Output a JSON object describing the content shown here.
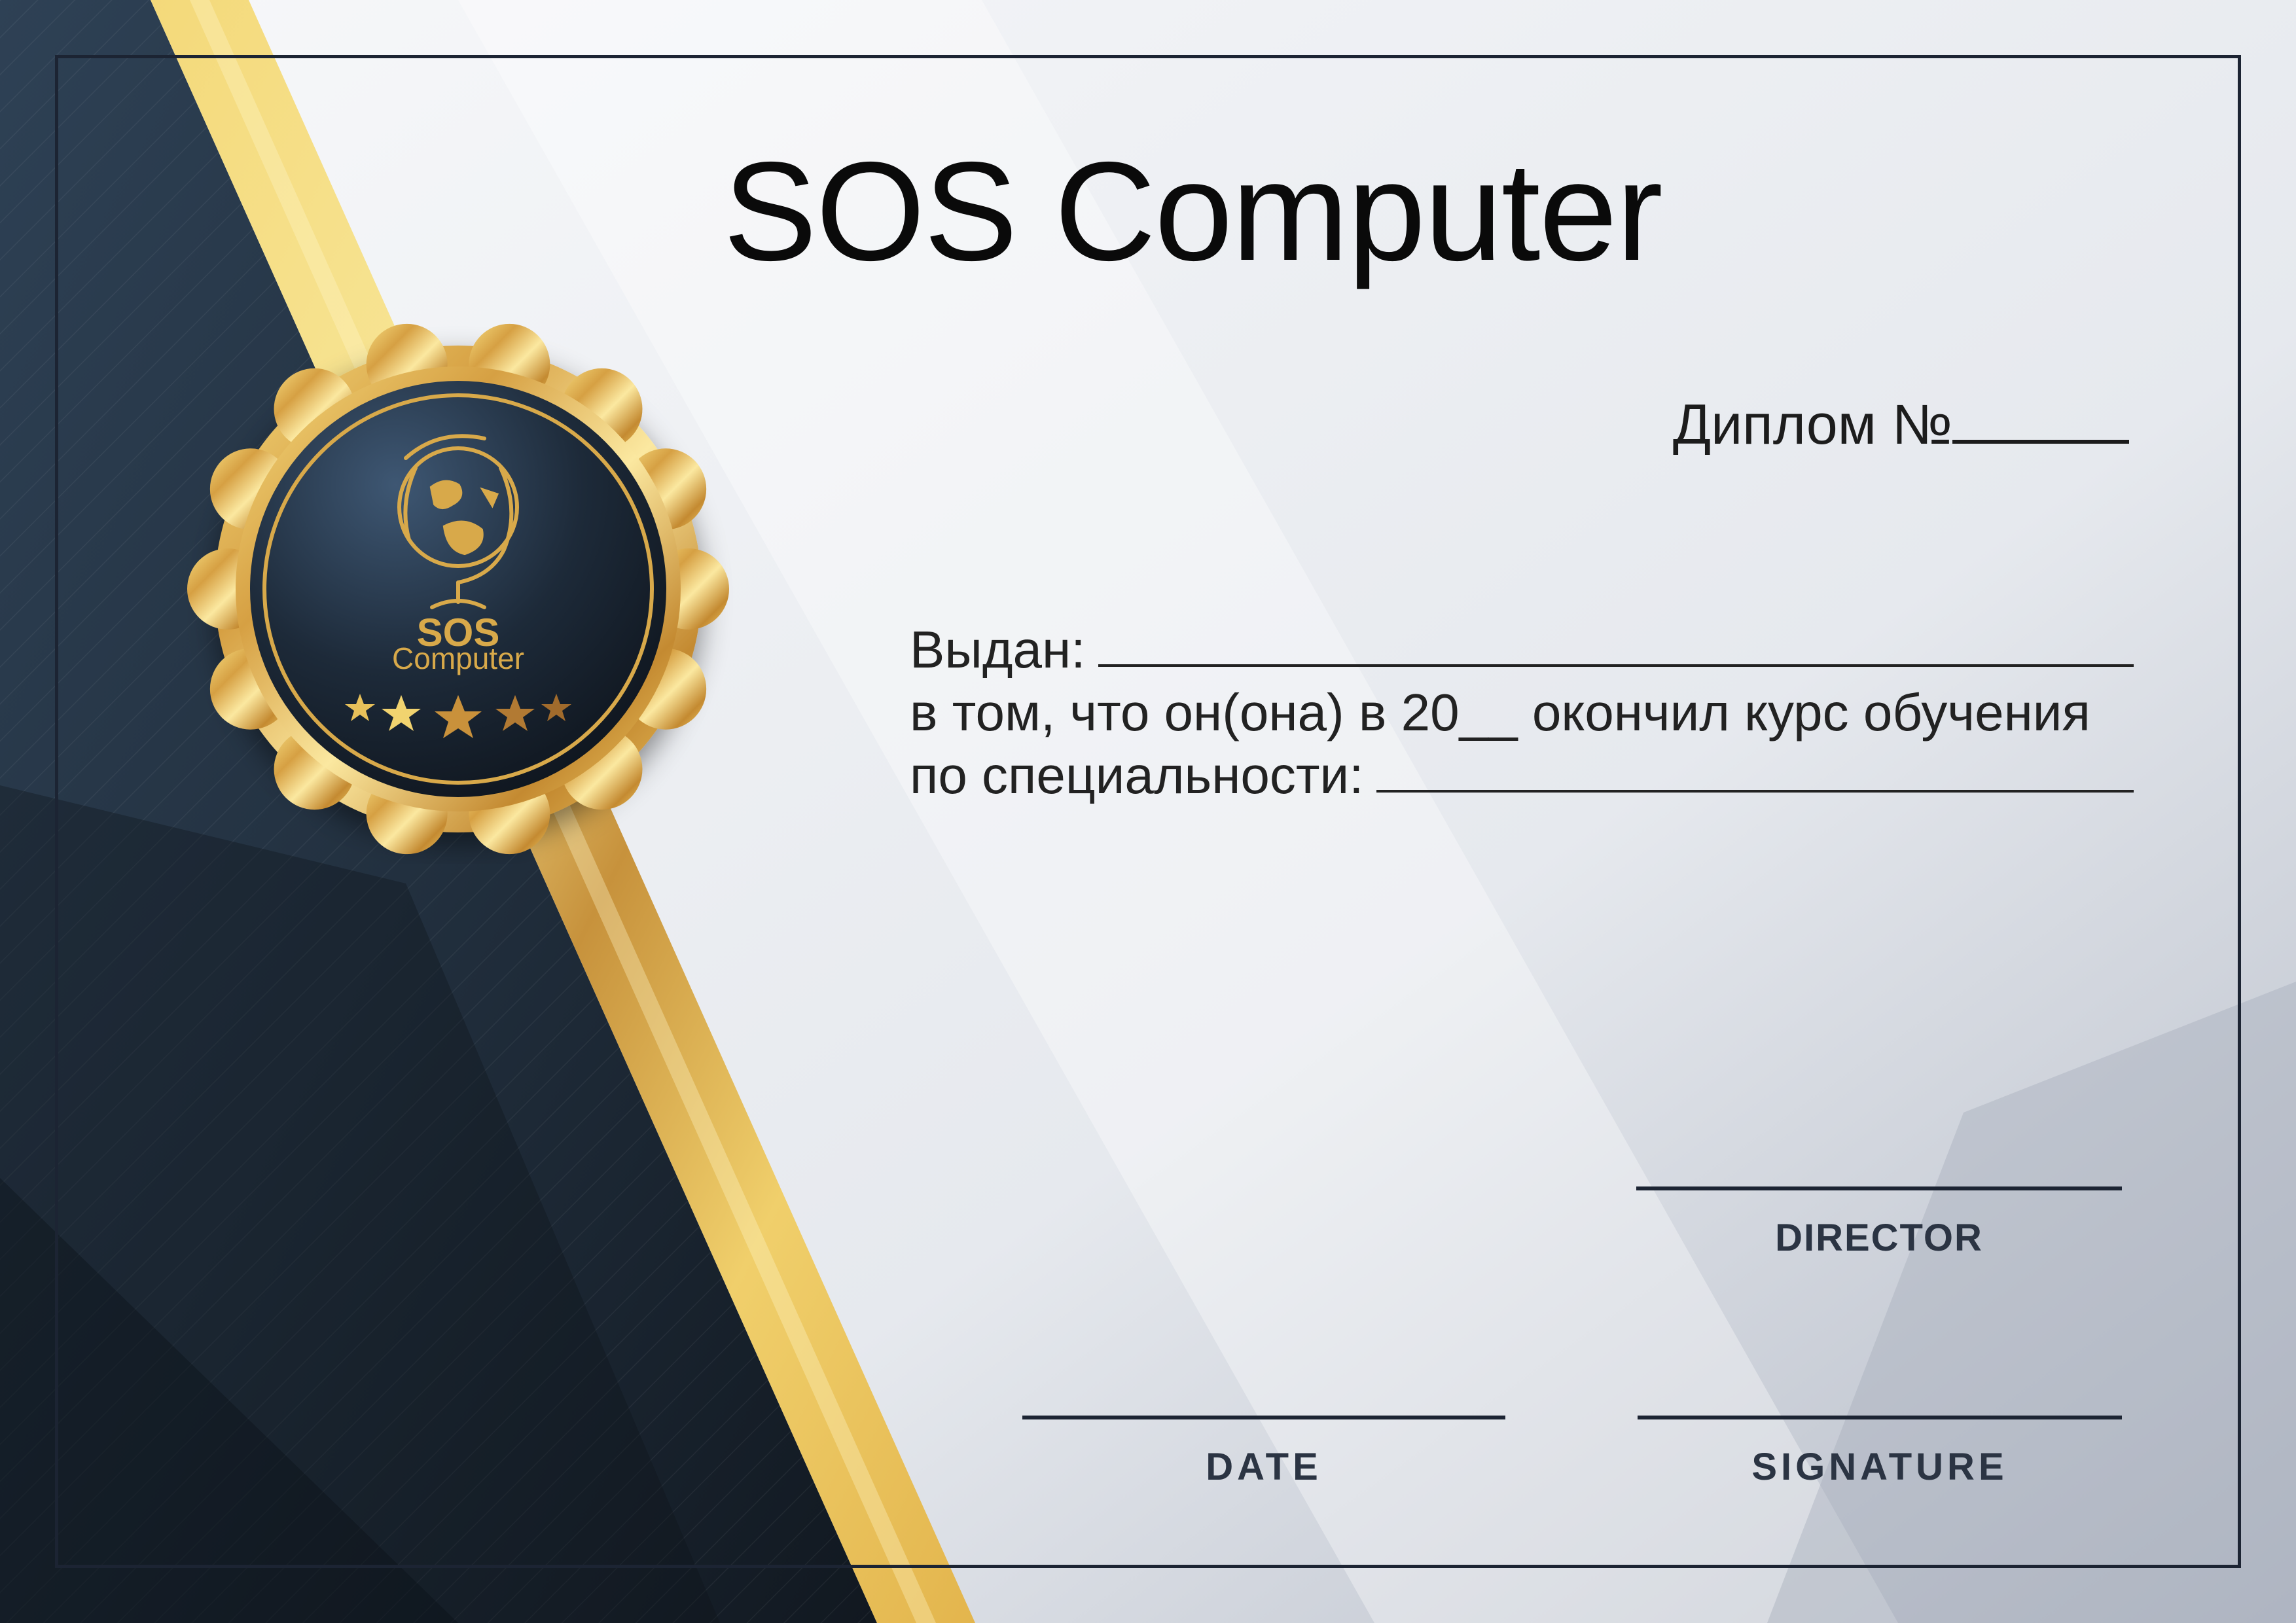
{
  "title": "SOS Computer",
  "diploma": {
    "label": "Диплом №"
  },
  "body": {
    "issued_label": "Выдан:",
    "line2": "в том, что он(она) в 20__ окончил курс обучения",
    "specialty_label": "по специальности:"
  },
  "seal": {
    "line1": "SOS",
    "line2": "Computer",
    "icon": "globe-icon",
    "stars": 5
  },
  "signatures": {
    "director": "DIRECTOR",
    "date": "DATE",
    "signature": "SIGNATURE"
  },
  "colors": {
    "navy": "#1c2b3d",
    "gold": "#e8c15a",
    "background": "#eef0f4"
  }
}
